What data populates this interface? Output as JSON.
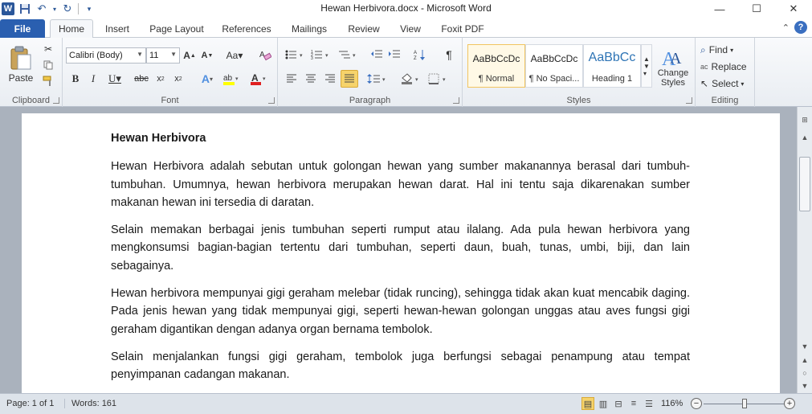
{
  "window": {
    "title": "Hewan Herbivora.docx - Microsoft Word",
    "min": "—",
    "max": "☐",
    "close": "✕"
  },
  "tabs": {
    "file": "File",
    "items": [
      "Home",
      "Insert",
      "Page Layout",
      "References",
      "Mailings",
      "Review",
      "View",
      "Foxit PDF"
    ],
    "active": "Home"
  },
  "ribbon": {
    "clipboard": {
      "label": "Clipboard",
      "paste": "Paste"
    },
    "font": {
      "label": "Font",
      "family": "Calibri (Body)",
      "size": "11"
    },
    "paragraph": {
      "label": "Paragraph"
    },
    "styles": {
      "label": "Styles",
      "items": [
        {
          "sample": "AaBbCcDc",
          "name": "¶ Normal"
        },
        {
          "sample": "AaBbCcDc",
          "name": "¶ No Spaci..."
        },
        {
          "sample": "AaBbCc",
          "name": "Heading 1"
        }
      ],
      "change": "Change Styles"
    },
    "editing": {
      "label": "Editing",
      "find": "Find",
      "replace": "Replace",
      "select": "Select"
    }
  },
  "document": {
    "heading": "Hewan Herbivora",
    "paragraphs": [
      "Hewan Herbivora adalah sebutan untuk golongan hewan yang sumber makanannya berasal dari tumbuh-tumbuhan. Umumnya, hewan herbivora merupakan hewan darat. Hal ini tentu saja dikarenakan sumber makanan hewan ini tersedia di daratan.",
      "Selain memakan berbagai jenis tumbuhan seperti rumput atau ilalang. Ada pula hewan herbivora yang mengkonsumsi bagian-bagian tertentu dari tumbuhan, seperti daun, buah, tunas, umbi, biji, dan lain sebagainya.",
      "Hewan herbivora mempunyai gigi geraham melebar (tidak runcing), sehingga tidak akan kuat mencabik daging. Pada jenis hewan yang tidak mempunyai gigi, seperti hewan-hewan golongan unggas atau aves fungsi gigi geraham digantikan dengan adanya organ bernama tembolok.",
      "Selain menjalankan fungsi gigi geraham, tembolok juga berfungsi sebagai penampung atau tempat penyimpanan cadangan makanan."
    ]
  },
  "status": {
    "page": "Page: 1 of 1",
    "words": "Words: 161",
    "zoom": "116%"
  }
}
